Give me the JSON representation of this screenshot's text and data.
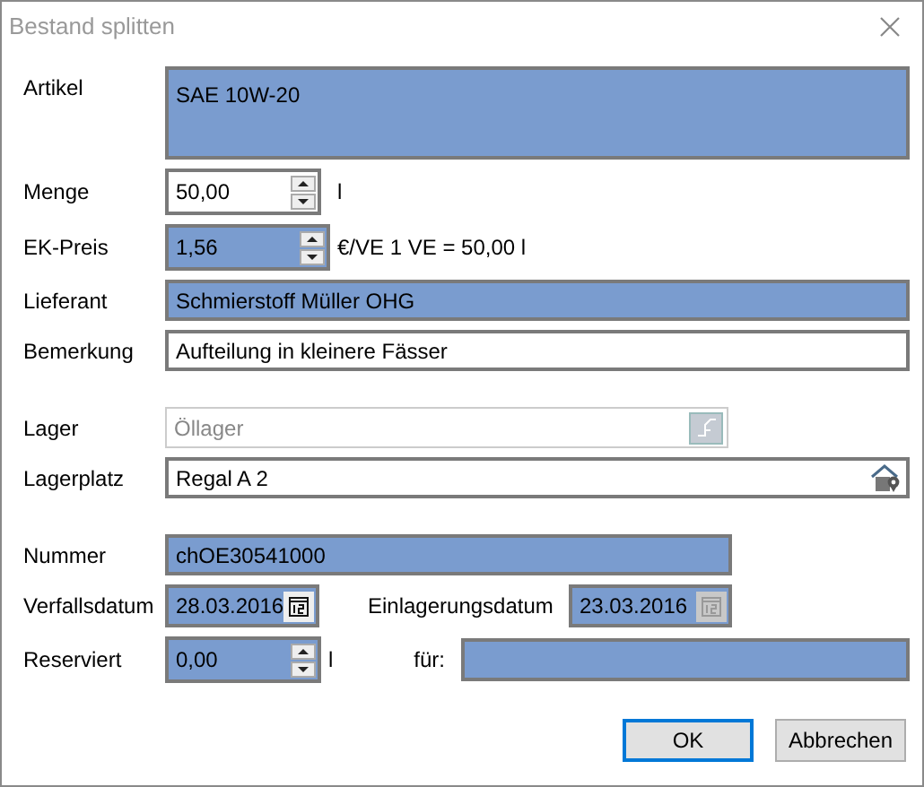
{
  "window": {
    "title": "Bestand splitten"
  },
  "groups": [
    [
      {
        "kind": "textarea",
        "label": "Artikel",
        "value": "SAE 10W-20",
        "highlighted": true
      },
      {
        "kind": "spin",
        "label": "Menge",
        "value": "50,00",
        "highlighted": false,
        "unit": "l"
      },
      {
        "kind": "spin",
        "label": "EK-Preis",
        "value": "1,56",
        "highlighted": true,
        "unit": "€/VE  1 VE = 50,00 l"
      },
      {
        "kind": "text",
        "label": "Lieferant",
        "value": "Schmierstoff Müller OHG",
        "highlighted": true
      },
      {
        "kind": "text",
        "label": "Bemerkung",
        "value": "Aufteilung in kleinere Fässer",
        "highlighted": false
      }
    ],
    [
      {
        "kind": "lookup",
        "label": "Lager",
        "value": "Öllager",
        "disabled": true
      },
      {
        "kind": "location",
        "label": "Lagerplatz",
        "value": "Regal A 2",
        "disabled": false
      }
    ],
    [
      {
        "kind": "short_text",
        "label": "Nummer",
        "value": "chOE30541000",
        "highlighted": true
      },
      {
        "kind": "date_pair",
        "label": "Verfallsdatum",
        "value": "28.03.2016",
        "highlighted": true,
        "button_disabled": false,
        "label_2": "Einlagerungsdatum",
        "value_2": "23.03.2016",
        "highlighted_2": true,
        "button_disabled_2": true
      },
      {
        "kind": "spin_target",
        "label": "Reserviert",
        "value": "0,00",
        "highlighted": true,
        "unit": "l",
        "label_2": "für:",
        "highlighted_2": true
      }
    ]
  ],
  "buttons": [
    {
      "label": "OK",
      "default": true
    },
    {
      "label": "Abbrechen",
      "default": false
    }
  ]
}
